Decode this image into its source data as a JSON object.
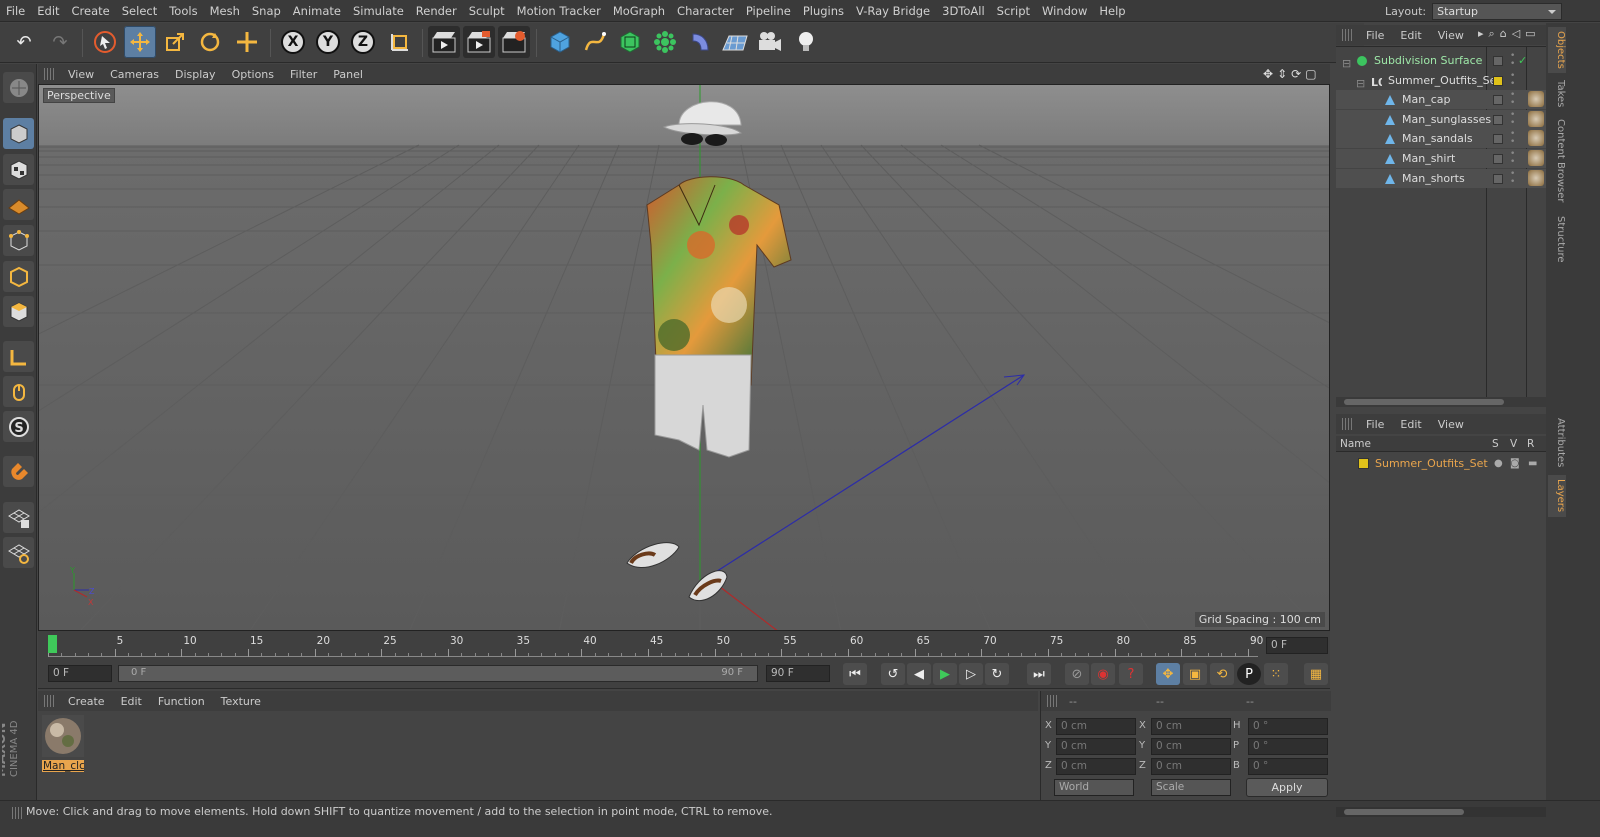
{
  "menu": [
    "File",
    "Edit",
    "Create",
    "Select",
    "Tools",
    "Mesh",
    "Snap",
    "Animate",
    "Simulate",
    "Render",
    "Sculpt",
    "Motion Tracker",
    "MoGraph",
    "Character",
    "Pipeline",
    "Plugins",
    "V-Ray Bridge",
    "3DToAll",
    "Script",
    "Window",
    "Help"
  ],
  "layout": {
    "label": "Layout:",
    "value": "Startup"
  },
  "viewport": {
    "menu": [
      "View",
      "Cameras",
      "Display",
      "Options",
      "Filter",
      "Panel"
    ],
    "label": "Perspective",
    "grid_spacing": "Grid Spacing : 100 cm"
  },
  "timeline": {
    "ticks": [
      "0",
      "5",
      "10",
      "15",
      "20",
      "25",
      "30",
      "35",
      "40",
      "45",
      "50",
      "55",
      "60",
      "65",
      "70",
      "75",
      "80",
      "85",
      "90"
    ],
    "current_frame": "0 F",
    "start_field": "0 F",
    "range_start": "0 F",
    "range_end": "90 F",
    "end_field": "90 F"
  },
  "material_manager": {
    "menu": [
      "Create",
      "Edit",
      "Function",
      "Texture"
    ],
    "materials": [
      {
        "name": "Man_clc"
      }
    ]
  },
  "coordinates": {
    "headers": [
      "--",
      "--",
      "--"
    ],
    "rows": [
      {
        "l1": "X",
        "v1": "0 cm",
        "l2": "X",
        "v2": "0 cm",
        "l3": "H",
        "v3": "0 °"
      },
      {
        "l1": "Y",
        "v1": "0 cm",
        "l2": "Y",
        "v2": "0 cm",
        "l3": "P",
        "v3": "0 °"
      },
      {
        "l1": "Z",
        "v1": "0 cm",
        "l2": "Z",
        "v2": "0 cm",
        "l3": "B",
        "v3": "0 °"
      }
    ],
    "space": "World",
    "mode": "Scale",
    "apply": "Apply"
  },
  "object_manager": {
    "menu": [
      "File",
      "Edit",
      "View"
    ],
    "objects": [
      {
        "name": "Subdivision Surface",
        "indent": 0
      },
      {
        "name": "Summer_Outfits_Set",
        "indent": 1
      },
      {
        "name": "Man_cap",
        "indent": 2
      },
      {
        "name": "Man_sunglasses",
        "indent": 2
      },
      {
        "name": "Man_sandals",
        "indent": 2
      },
      {
        "name": "Man_shirt",
        "indent": 2
      },
      {
        "name": "Man_shorts",
        "indent": 2
      }
    ]
  },
  "layer_manager": {
    "menu": [
      "File",
      "Edit",
      "View"
    ],
    "columns": {
      "name": "Name",
      "s": "S",
      "v": "V",
      "r": "R"
    },
    "layers": [
      {
        "name": "Summer_Outfits_Set",
        "color": "#e0c21a"
      }
    ]
  },
  "side_tabs": [
    "Objects",
    "Takes",
    "Content Browser",
    "Structure"
  ],
  "side_tabs_lower": [
    "Attributes",
    "Layers"
  ],
  "brand": {
    "line1": "MAXON",
    "line2": "CINEMA 4D"
  },
  "status": "Move: Click and drag to move elements. Hold down SHIFT to quantize movement / add to the selection in point mode, CTRL to remove.",
  "colors": {
    "accent": "#5d7fa3",
    "selection": "#e9a54d",
    "layer": "#e0c21a"
  }
}
